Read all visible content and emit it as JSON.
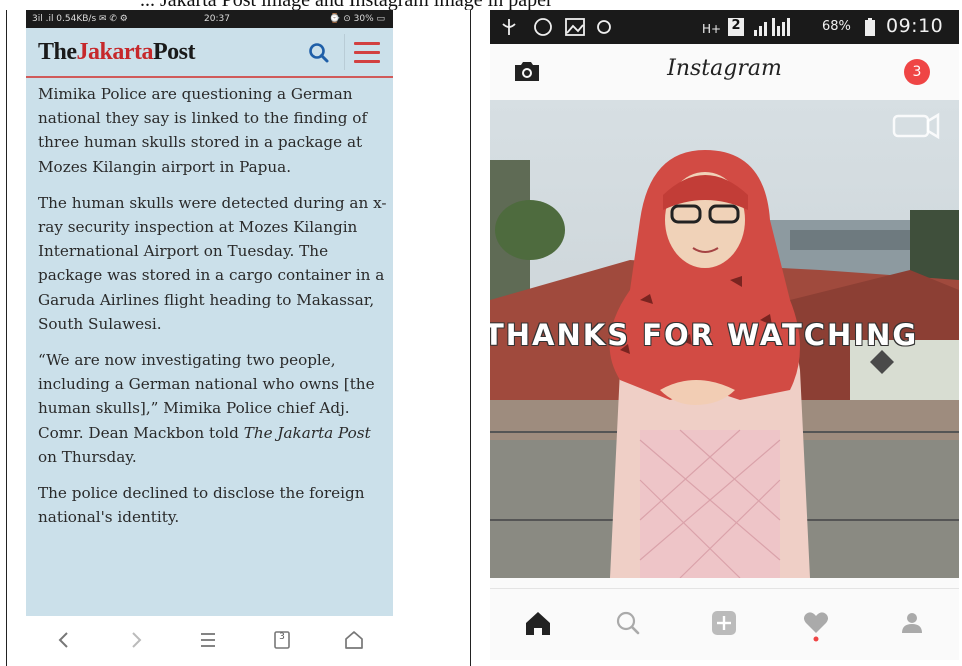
{
  "caption_fragment": "... Jakarta Post image and Instagram image in paper",
  "left_phone": {
    "status": {
      "left_text": "3il .il 0.54KB/s ✉ ✆ ⚙",
      "time": "20:37",
      "right_text": "⌚ ⊙ 30% ▭"
    },
    "header": {
      "logo_part1": "The",
      "logo_part2": "Jakarta",
      "logo_part3": "Post"
    },
    "article": {
      "p1": "Mimika Police are questioning a German national they say is linked to the finding of three human skulls stored in a package at Mozes Kilangin airport in Papua.",
      "p2": "The human skulls were detected during an x-ray security inspection at Mozes Kilangin International Airport on Tuesday. The package was stored in a cargo container in a Garuda Airlines flight heading to Makassar, South Sulawesi.",
      "p3_a": "“We are now investigating two people, including a German national who owns [the human skulls],” Mimika Police chief Adj. Comr. Dean Mackbon told ",
      "p3_em": "The Jakarta Post",
      "p3_b": " on Thursday.",
      "p4": "The police declined to disclose the foreign national's identity."
    },
    "nav": {
      "tab_count": "3"
    }
  },
  "right_phone": {
    "status": {
      "battery_pct": "68%",
      "time": "09:10",
      "sim_label": "2"
    },
    "app_title": "Instagram",
    "notification_count": "3",
    "overlay_text": "THANKS FOR WATCHING"
  },
  "colors": {
    "jp_red": "#c6282b",
    "jp_bg": "#cbe0ea",
    "ig_badge": "#ef4545"
  }
}
